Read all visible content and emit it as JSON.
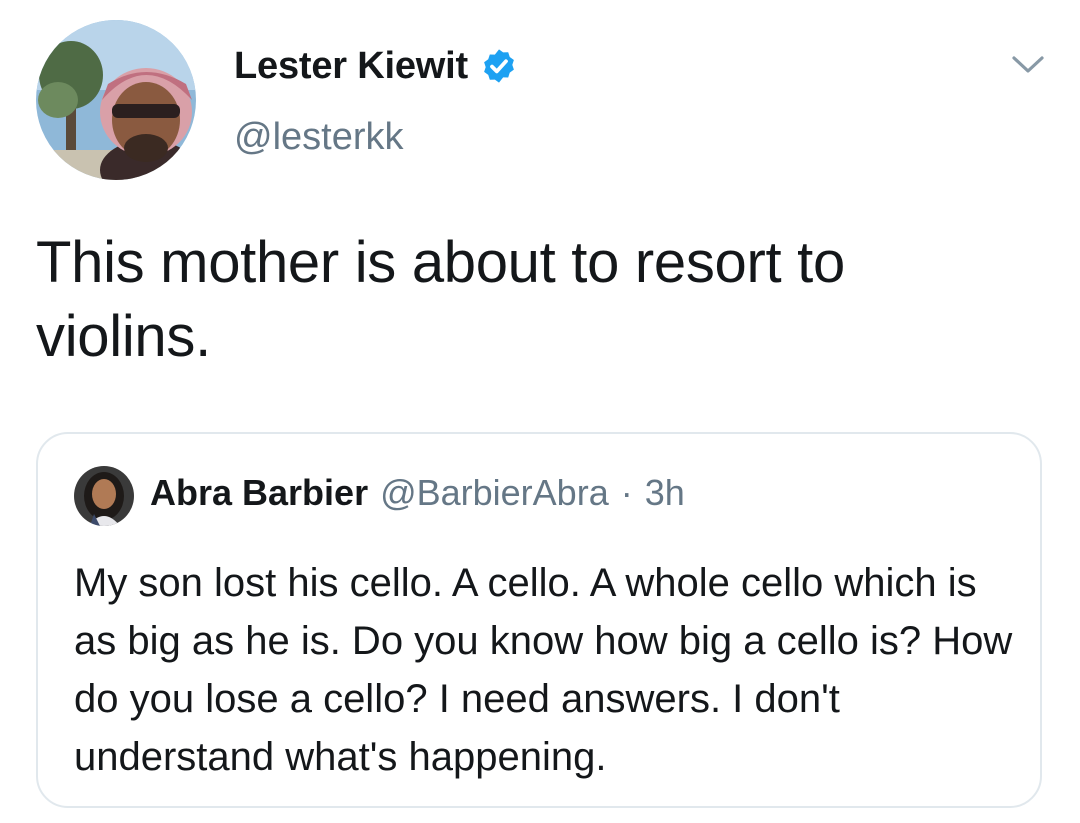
{
  "author": {
    "name": "Lester Kiewit",
    "handle": "@lesterkk",
    "verified": true
  },
  "tweet": {
    "text": "This mother is about to resort to violins."
  },
  "quoted_tweet": {
    "name": "Abra Barbier",
    "handle": "@BarbierAbra",
    "separator": "·",
    "time": "3h",
    "text": "My son lost his cello. A cello. A whole cello which is as big as he is. Do you know how big a cello is? How do you lose a cello? I need answers. I don't understand what's happening."
  },
  "icons": {
    "verified": "verified-badge-icon",
    "menu": "chevron-down-icon"
  },
  "colors": {
    "text": "#14171a",
    "secondary": "#657786",
    "verified": "#1da1f2",
    "border": "#e1e8ed"
  }
}
